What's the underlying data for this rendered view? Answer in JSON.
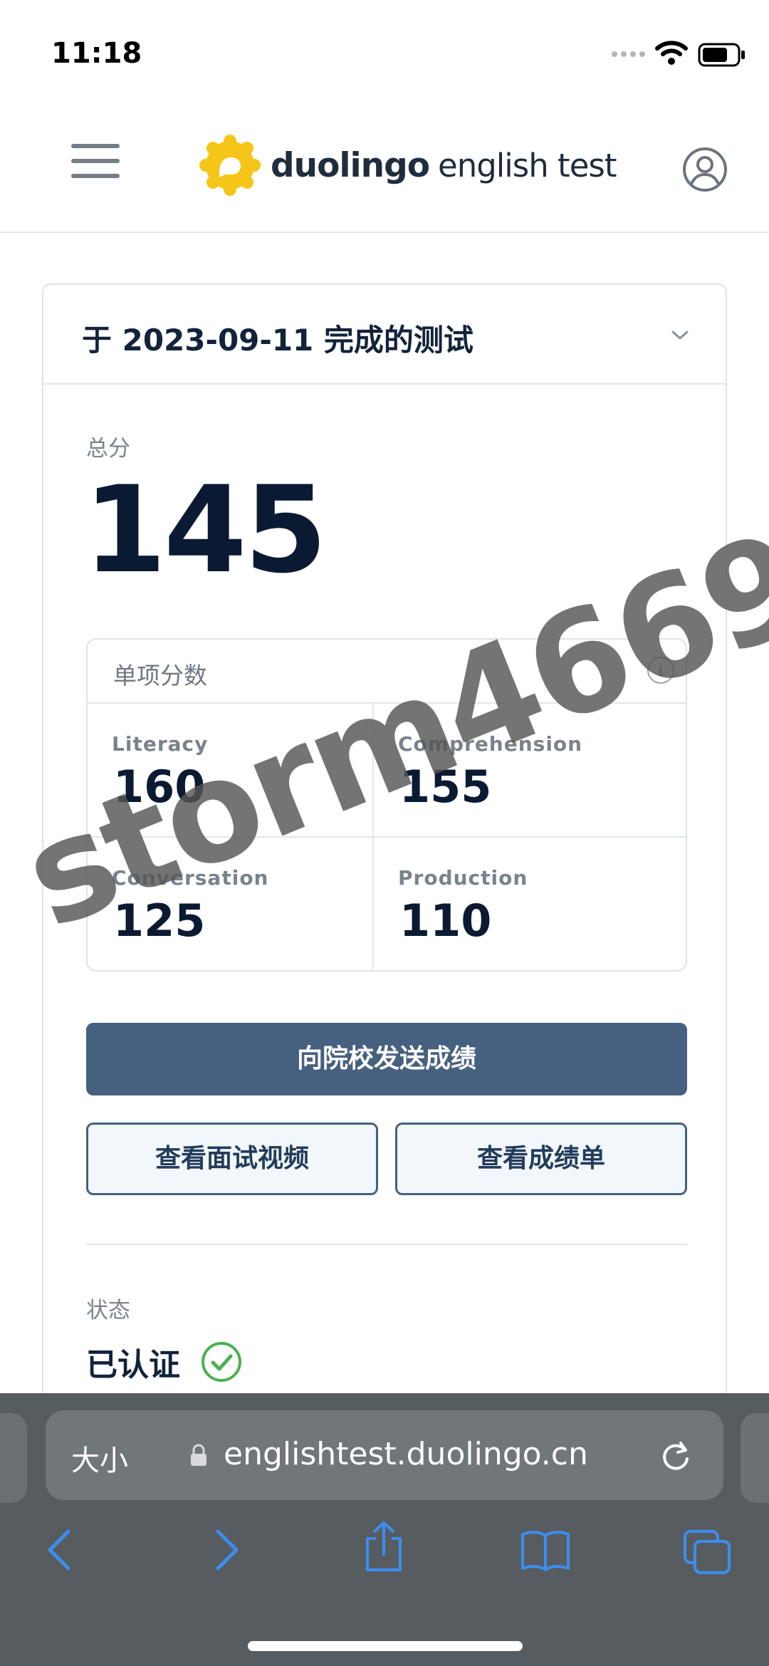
{
  "status_bar": {
    "time": "11:18"
  },
  "header": {
    "logo_brand": "duolingo",
    "logo_product": "english test",
    "colors": {
      "logo_yellow": "#f5c518"
    }
  },
  "card": {
    "title": "于 2023-09-11 完成的测试",
    "total_label": "总分",
    "total_score": "145",
    "subscores_title": "单项分数",
    "subscores": [
      {
        "label": "Literacy",
        "value": "160"
      },
      {
        "label": "Comprehension",
        "value": "155"
      },
      {
        "label": "Conversation",
        "value": "125"
      },
      {
        "label": "Production",
        "value": "110"
      }
    ],
    "send_button": "向院校发送成绩",
    "video_button": "查看面试视频",
    "report_button": "查看成绩单",
    "status_label": "状态",
    "status_value": "已认证",
    "colors": {
      "primary": "#46607f",
      "verified": "#4caf50"
    }
  },
  "browser": {
    "text_size_label": "大小",
    "url": "englishtest.duolingo.cn"
  },
  "watermark": "storm4669"
}
